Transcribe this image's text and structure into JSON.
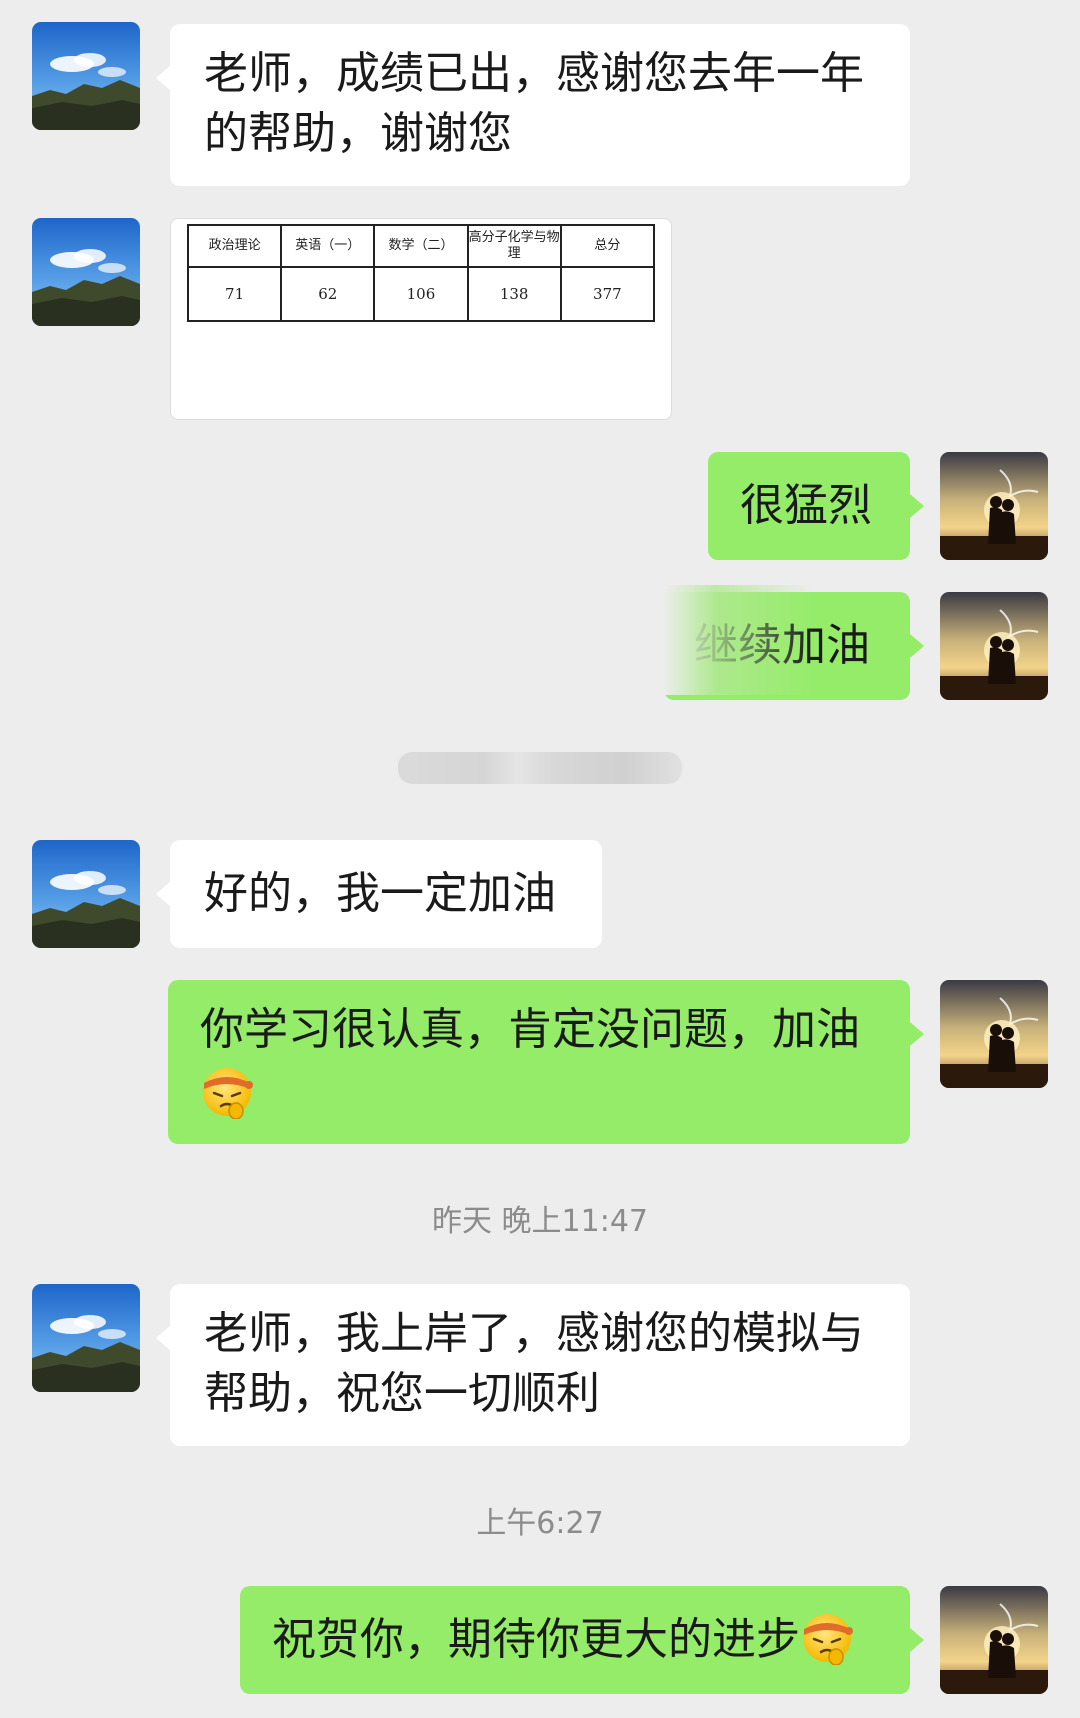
{
  "messages": [
    {
      "side": "left",
      "text": "老师，成绩已出，感谢您去年一年的帮助，谢谢您"
    },
    {
      "side": "left",
      "type": "scores",
      "headers": [
        "政治理论",
        "英语（一）",
        "数学（二）",
        "高分子化学与物理",
        "总分"
      ],
      "values": [
        "71",
        "62",
        "106",
        "138",
        "377"
      ]
    },
    {
      "side": "right",
      "text": "很猛烈"
    },
    {
      "side": "right",
      "text": "继续加油"
    },
    {
      "side": "left",
      "text": "好的，我一定加油"
    },
    {
      "side": "right",
      "text": "你学习很认真，肯定没问题，加油"
    },
    {
      "side": "left",
      "text": "老师，我上岸了，感谢您的模拟与帮助，祝您一切顺利"
    },
    {
      "side": "right",
      "text": "祝贺你，期待你更大的进步"
    }
  ],
  "timestamps": [
    "昨天 晚上11:47",
    "上午6:27"
  ],
  "icons": {
    "contact_avatar": "mountain-sky-avatar",
    "own_avatar": "sunset-couple-avatar",
    "emoji": "determined-face-emoji"
  },
  "colors": {
    "background": "#ededed",
    "incoming": "#ffffff",
    "outgoing": "#95ec69"
  }
}
